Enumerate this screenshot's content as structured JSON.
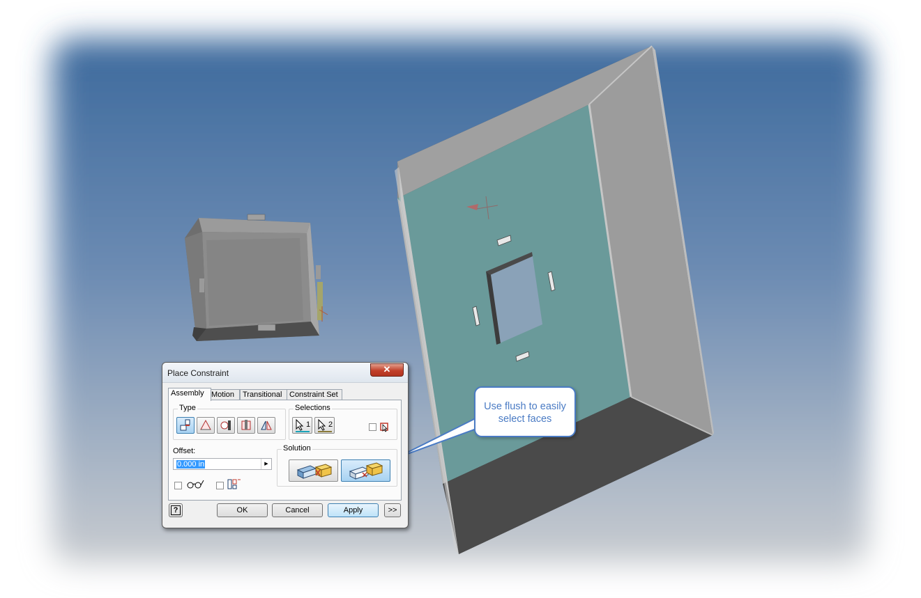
{
  "colors": {
    "viewport_top": "#3d6a9d",
    "viewport_bottom": "#c9ccd0",
    "part_face": "#8c8c8c",
    "plate_face": "#6a9a9a",
    "callout_accent": "#4a7bc4",
    "close_button": "#c1402a"
  },
  "dialog": {
    "title": "Place Constraint",
    "close_glyph": "✕",
    "tabs": [
      "Assembly",
      "Motion",
      "Transitional",
      "Constraint Set"
    ],
    "active_tab": "Assembly",
    "type_group_label": "Type",
    "type_buttons": [
      {
        "icon": "mate-icon",
        "selected": true
      },
      {
        "icon": "angle-icon",
        "selected": false
      },
      {
        "icon": "tangent-icon",
        "selected": false
      },
      {
        "icon": "insert-icon",
        "selected": false
      },
      {
        "icon": "symmetry-icon",
        "selected": false
      }
    ],
    "selections_group_label": "Selections",
    "selection_1_label": "1",
    "selection_2_label": "2",
    "first_occurrence_icon": "pick-part-first-icon",
    "offset_label": "Offset:",
    "offset_value": "0.000 in",
    "preview_icon": "glasses-icon",
    "predict_offset_icon": "predict-offset-icon",
    "solution_group_label": "Solution",
    "solution_buttons": [
      {
        "icon": "mate-solution-icon",
        "selected": false
      },
      {
        "icon": "flush-solution-icon",
        "selected": true
      }
    ],
    "help_glyph": "?",
    "ok_label": "OK",
    "cancel_label": "Cancel",
    "apply_label": "Apply",
    "more_label": ">>"
  },
  "callout": {
    "text_line1": "Use flush to easily",
    "text_line2": "select faces"
  }
}
